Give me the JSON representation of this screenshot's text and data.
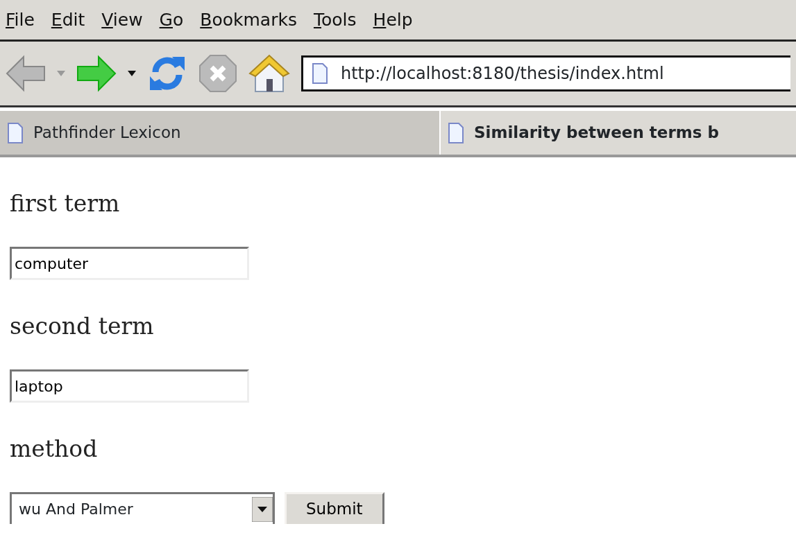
{
  "menu": [
    "File",
    "Edit",
    "View",
    "Go",
    "Bookmarks",
    "Tools",
    "Help"
  ],
  "toolbar": {
    "back_disabled": true,
    "stop_disabled": true,
    "url": "http://localhost:8180/thesis/index.html"
  },
  "tabs": [
    {
      "label": "Pathfinder Lexicon",
      "selected": false
    },
    {
      "label": "Similarity between terms b",
      "selected": true
    }
  ],
  "form": {
    "fields": [
      {
        "label": "first term",
        "value": "computer"
      },
      {
        "label": "second term",
        "value": "laptop"
      }
    ],
    "method": {
      "label": "method",
      "value": "wu And Palmer"
    },
    "submit": "Submit"
  }
}
